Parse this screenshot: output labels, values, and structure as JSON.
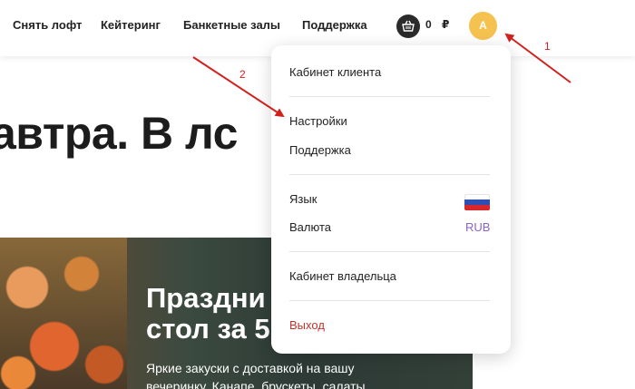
{
  "nav": {
    "items": [
      "Снять лофт",
      "Кейтеринг",
      "Банкетные залы",
      "Поддержка"
    ],
    "cart_count": "0",
    "currency_sign": "₽",
    "avatar_letter": "A"
  },
  "hero": {
    "title": "автра. В лс"
  },
  "promo": {
    "title_line1": "Праздни",
    "title_line2": "стол за 5",
    "text_line1": "Яркие закуски с доставкой на вашу",
    "text_line2": "вечеринку. Канапе, брускеты, салаты"
  },
  "dropdown": {
    "client_cabinet": "Кабинет клиента",
    "settings": "Настройки",
    "support": "Поддержка",
    "language_label": "Язык",
    "currency_label": "Валюта",
    "currency_value": "RUB",
    "owner_cabinet": "Кабинет владельца",
    "logout": "Выход"
  },
  "annotations": {
    "label1": "1",
    "label2": "2",
    "arrow_color": "#d0211d"
  },
  "colors": {
    "avatar": "#f5c24f",
    "logout": "#c0342b",
    "currency_value": "#8a63c9"
  }
}
